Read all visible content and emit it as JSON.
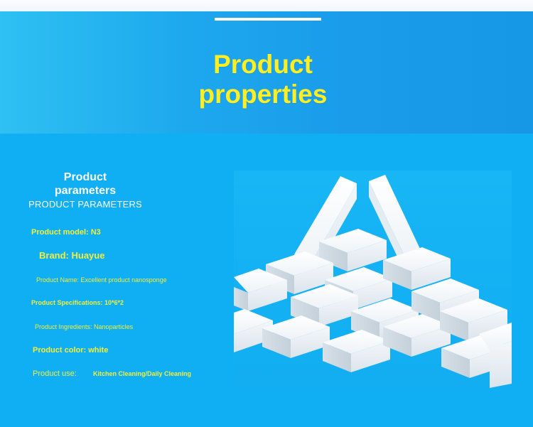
{
  "header": {
    "title_line1": "Product",
    "title_line2": "properties"
  },
  "params": {
    "title_line1": "Product",
    "title_line2": "parameters",
    "subtitle": "PRODUCT PARAMETERS",
    "model": "Product model: N3",
    "brand": "Brand: Huayue",
    "name": "Product Name: Excellent product nanosponge",
    "specs": "Product Specifications: 10*6*2",
    "ingredients": "Product Ingredients: Nanoparticles",
    "color": "Product color: white",
    "use_label": "Product use:",
    "use_value": "Kitchen Cleaning/Daily Cleaning"
  },
  "colors": {
    "accent_title": "#ffee22",
    "param_text": "#f3ee3a",
    "background": "#10aef2"
  },
  "image": {
    "subject": "white-melamine-sponge-blocks"
  }
}
